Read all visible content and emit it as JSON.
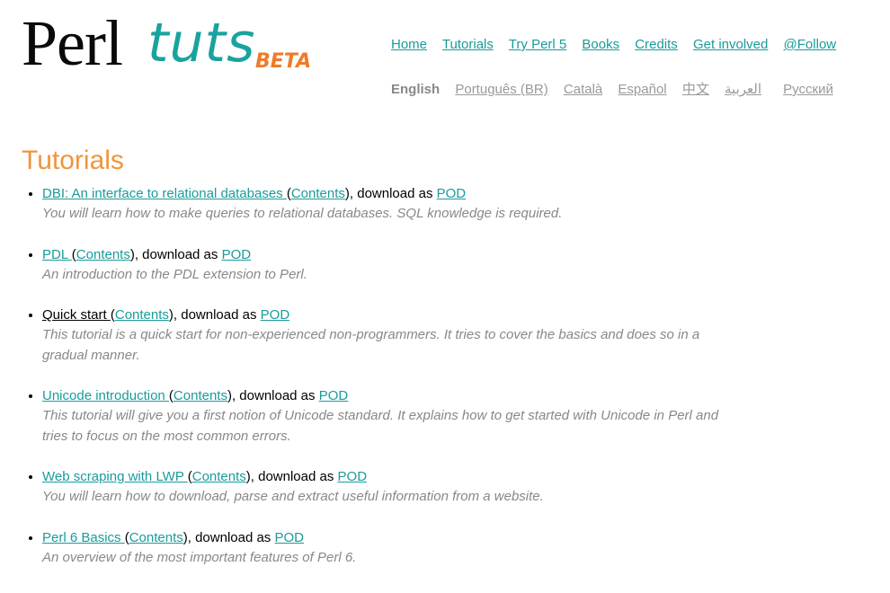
{
  "logo": {
    "perl": "Perl",
    "tuts": "tuts",
    "beta": "BETA"
  },
  "nav": {
    "items": [
      "Home",
      "Tutorials",
      "Try Perl 5",
      "Books",
      "Credits",
      "Get involved",
      "@Follow"
    ]
  },
  "languages": {
    "current": "English",
    "items": [
      "Português (BR)",
      "Català",
      "Español",
      "中文",
      "العربية",
      "Русский"
    ]
  },
  "page_title": "Tutorials",
  "tutorials": [
    {
      "title": "DBI: An interface to relational databases ",
      "contents": "Contents",
      "download_text": "), download as ",
      "pod": "POD",
      "description": "You will learn how to make queries to relational databases. SQL knowledge is required."
    },
    {
      "title": "PDL ",
      "contents": "Contents",
      "download_text": "), download as ",
      "pod": "POD",
      "description": "An introduction to the PDL extension to Perl."
    },
    {
      "title": "Quick start ",
      "contents": "Contents",
      "download_text": "), download as ",
      "pod": "POD",
      "description": "This tutorial is a quick start for non-experienced non-programmers. It tries to cover the basics and does so in a gradual manner."
    },
    {
      "title": "Unicode introduction ",
      "contents": "Contents",
      "download_text": "), download as ",
      "pod": "POD",
      "description": "This tutorial will give you a first notion of Unicode standard. It explains how to get started with Unicode in Perl and tries to focus on the most common errors."
    },
    {
      "title": "Web scraping with LWP ",
      "contents": "Contents",
      "download_text": "), download as ",
      "pod": "POD",
      "description": "You will learn how to download, parse and extract useful information from a website."
    },
    {
      "title": "Perl 6 Basics ",
      "contents": "Contents",
      "download_text": "), download as ",
      "pod": "POD",
      "description": "An overview of the most important features of Perl 6."
    }
  ],
  "colors": {
    "link": "#1a9b9b",
    "title": "#f0953c",
    "beta": "#f07a2a",
    "description": "#888888"
  }
}
